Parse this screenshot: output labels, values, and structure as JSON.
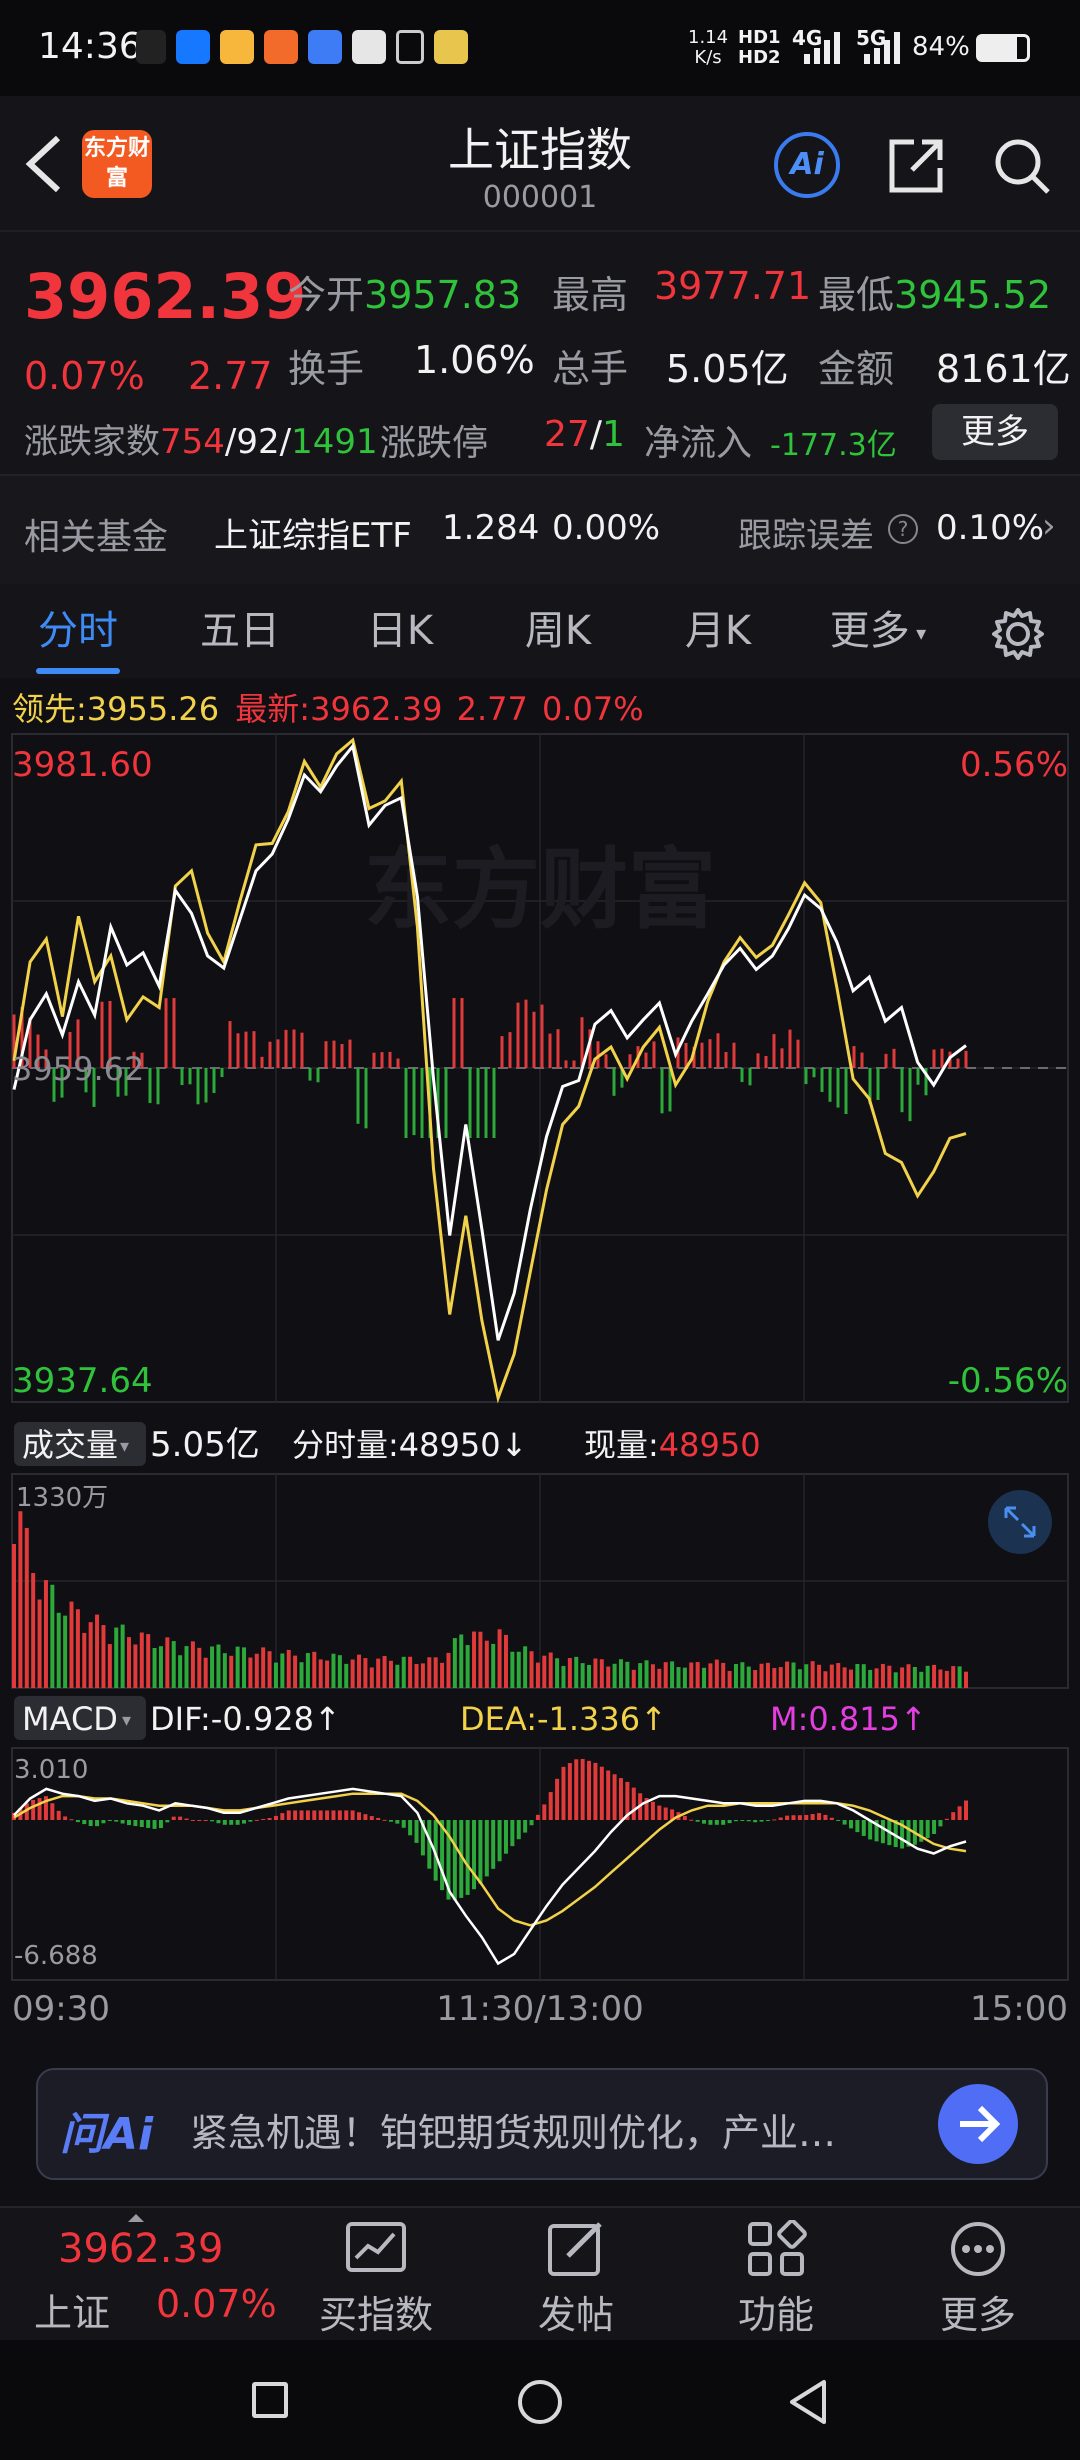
{
  "status_bar": {
    "time": "14:36",
    "net_speed_value": "1.14",
    "net_speed_unit": "K/s",
    "network1": "HD1",
    "network2": "HD2",
    "net_4g": "4G",
    "net_5g": "5G",
    "battery": "84%"
  },
  "header": {
    "logo_text": "东方财富",
    "title": "上证指数",
    "code": "000001",
    "ai_label": "Ai"
  },
  "quote": {
    "price": "3962.39",
    "change_pct": "0.07%",
    "change": "2.77",
    "open_label": "今开",
    "open": "3957.83",
    "high_label": "最高",
    "high": "3977.71",
    "low_label": "最低",
    "low": "3945.52",
    "turnover_label": "换手",
    "turnover": "1.06%",
    "volume_label": "总手",
    "volume": "5.05亿",
    "amount_label": "金额",
    "amount": "8161亿",
    "breadth_label": "涨跌家数",
    "up_count": "754",
    "flat_count": "92",
    "down_count": "1491",
    "limit_label": "涨跌停",
    "limit_up": "27",
    "limit_down": "1",
    "netflow_label": "净流入",
    "netflow": "-177.3亿",
    "more_button": "更多"
  },
  "fund": {
    "label": "相关基金",
    "name": "上证综指ETF",
    "price": "1.284",
    "change": "0.00%",
    "tracking_label": "跟踪误差",
    "tracking_value": "0.10%"
  },
  "tabs": [
    "分时",
    "五日",
    "日K",
    "周K",
    "月K",
    "更多"
  ],
  "legend": {
    "lead_label": "领先:",
    "lead_value": "3955.26",
    "latest_label": "最新:",
    "latest_value": "3962.39",
    "latest_change": "2.77",
    "latest_pct": "0.07%"
  },
  "price_chart": {
    "max_label": "3981.60",
    "min_label": "3937.64",
    "max_pct": "0.56%",
    "min_pct": "-0.56%",
    "prev_close_label": "3959.62",
    "watermark": "东方财富"
  },
  "volume_panel": {
    "selector": "成交量",
    "total": "5.05亿",
    "minute_label": "分时量:",
    "minute_value": "48950",
    "minute_arrow": "↓",
    "current_label": "现量:",
    "current_value": "48950",
    "scale_label": "1330万"
  },
  "macd_panel": {
    "selector": "MACD",
    "dif_label": "DIF:",
    "dif_value": "-0.928",
    "dea_label": "DEA:",
    "dea_value": "-1.336",
    "m_label": "M:",
    "m_value": "0.815",
    "up_arrow": "↑",
    "top_label": "3.010",
    "bottom_label": "-6.688"
  },
  "time_axis": [
    "09:30",
    "11:30/13:00",
    "15:00"
  ],
  "ai_bar": {
    "brand": "问Ai",
    "text": "紧急机遇！铂钯期货规则优化，产业…"
  },
  "bottom_nav": {
    "index_price": "3962.39",
    "index_name": "上证",
    "index_pct": "0.07%",
    "items": [
      "买指数",
      "发帖",
      "功能",
      "更多"
    ]
  },
  "chart_data": [
    {
      "type": "line",
      "title": "",
      "ylim": [
        3937.64,
        3981.6
      ],
      "y_ticks": [
        "3981.60",
        "3959.62",
        "3937.64"
      ],
      "x_ticks": [
        "09:30",
        "11:30/13:00",
        "15:00"
      ],
      "prev_close": 3959.62,
      "series": [
        {
          "name": "最新",
          "color": "#ffffff",
          "values": [
            3958.2,
            3962.8,
            3964.5,
            3961.8,
            3965.3,
            3963.1,
            3968.9,
            3966.4,
            3967.2,
            3965.0,
            3971.3,
            3969.8,
            3967.0,
            3966.2,
            3969.4,
            3972.6,
            3973.7,
            3976.0,
            3978.9,
            3977.8,
            3979.5,
            3980.8,
            3975.6,
            3976.9,
            3977.4,
            3970.9,
            3958.9,
            3948.6,
            3955.9,
            3949.0,
            3941.7,
            3944.8,
            3950.3,
            3955.1,
            3958.4,
            3958.8,
            3962.5,
            3963.4,
            3961.6,
            3962.8,
            3963.9,
            3960.5,
            3962.7,
            3964.5,
            3966.4,
            3967.5,
            3966.1,
            3967.0,
            3968.8,
            3971.0,
            3970.1,
            3967.9,
            3964.7,
            3965.6,
            3962.7,
            3963.6,
            3960.0,
            3958.5,
            3960.3,
            3961.1
          ]
        },
        {
          "name": "领先",
          "color": "#f2d24a",
          "values": [
            3960.1,
            3966.6,
            3968.1,
            3963.0,
            3969.6,
            3965.3,
            3967.0,
            3962.8,
            3964.3,
            3963.6,
            3971.6,
            3972.6,
            3968.5,
            3966.6,
            3970.6,
            3974.3,
            3974.4,
            3976.5,
            3979.8,
            3978.1,
            3980.3,
            3981.2,
            3976.7,
            3977.2,
            3978.5,
            3968.9,
            3953.0,
            3943.4,
            3949.9,
            3943.0,
            3937.9,
            3940.8,
            3946.2,
            3951.6,
            3955.9,
            3957.1,
            3960.2,
            3961.0,
            3958.9,
            3961.0,
            3962.3,
            3958.5,
            3960.2,
            3964.0,
            3966.6,
            3968.2,
            3966.9,
            3967.7,
            3969.7,
            3971.8,
            3970.5,
            3964.9,
            3958.9,
            3957.6,
            3954.0,
            3953.4,
            3951.2,
            3952.8,
            3955.0,
            3955.3
          ]
        }
      ]
    },
    {
      "type": "bar",
      "title": "成交量",
      "ylim": [
        0,
        13300000
      ],
      "y_ticks": [
        "1330万"
      ],
      "x_ticks": [
        "09:30",
        "11:30/13:00",
        "15:00"
      ],
      "series": [
        {
          "name": "成交量",
          "values": [
            13300000,
            8200000,
            6500000,
            5400000,
            4800000,
            4300000,
            3900000,
            3600000,
            3300000,
            3000000,
            2900000,
            2700000,
            2600000,
            2500000,
            2450000,
            2400000,
            2300000,
            2200000,
            2150000,
            2100000,
            2000000,
            1950000,
            1900000,
            1850000,
            1900000,
            1800000,
            1800000,
            2400000,
            3900000,
            3200000,
            3600000,
            2700000,
            2300000,
            2100000,
            1900000,
            1800000,
            1750000,
            1700000,
            1650000,
            1600000,
            1600000,
            1550000,
            1500000,
            1700000,
            1600000,
            1500000,
            1450000,
            1500000,
            1550000,
            1600000,
            1500000,
            1450000,
            1450000,
            1400000,
            1400000,
            1350000,
            1400000,
            1350000,
            1300000,
            1300000
          ]
        }
      ]
    },
    {
      "type": "line",
      "title": "MACD",
      "ylim": [
        -6.688,
        3.01
      ],
      "y_ticks": [
        "3.010",
        "-6.688"
      ],
      "x_ticks": [
        "09:30",
        "11:30/13:00",
        "15:00"
      ],
      "series": [
        {
          "name": "DIF",
          "color": "#ffffff",
          "values": [
            0.2,
            0.9,
            1.3,
            1.1,
            1.0,
            0.8,
            0.9,
            0.7,
            0.6,
            0.4,
            0.7,
            0.6,
            0.5,
            0.3,
            0.3,
            0.5,
            0.7,
            0.9,
            1.0,
            1.1,
            1.2,
            1.3,
            1.2,
            1.1,
            1.0,
            0.3,
            -1.2,
            -3.0,
            -4.0,
            -4.9,
            -6.0,
            -5.6,
            -4.6,
            -3.6,
            -2.7,
            -2.0,
            -1.3,
            -0.5,
            0.2,
            0.7,
            1.0,
            1.0,
            0.9,
            0.8,
            0.7,
            0.7,
            0.6,
            0.6,
            0.7,
            0.8,
            0.8,
            0.7,
            0.4,
            0.0,
            -0.4,
            -0.8,
            -1.2,
            -1.4,
            -1.1,
            -0.9
          ]
        },
        {
          "name": "DEA",
          "color": "#f2d24a",
          "values": [
            0.1,
            0.5,
            0.8,
            1.0,
            1.0,
            0.9,
            0.9,
            0.8,
            0.7,
            0.6,
            0.6,
            0.6,
            0.5,
            0.4,
            0.4,
            0.5,
            0.6,
            0.7,
            0.8,
            0.9,
            1.0,
            1.1,
            1.1,
            1.1,
            1.1,
            0.8,
            0.2,
            -0.7,
            -1.8,
            -2.7,
            -3.7,
            -4.2,
            -4.4,
            -4.2,
            -3.8,
            -3.3,
            -2.8,
            -2.2,
            -1.6,
            -1.0,
            -0.4,
            0.1,
            0.4,
            0.6,
            0.6,
            0.7,
            0.7,
            0.7,
            0.7,
            0.7,
            0.7,
            0.7,
            0.6,
            0.4,
            0.1,
            -0.2,
            -0.6,
            -1.0,
            -1.2,
            -1.3
          ]
        },
        {
          "name": "M",
          "values": [
            0.3,
            0.8,
            1.0,
            0.2,
            -0.1,
            -0.3,
            0.0,
            -0.2,
            -0.3,
            -0.4,
            0.2,
            0.0,
            0.0,
            -0.2,
            -0.2,
            0.0,
            0.1,
            0.4,
            0.4,
            0.4,
            0.4,
            0.4,
            0.2,
            0.0,
            -0.2,
            -1.0,
            -2.4,
            -3.4,
            -3.2,
            -2.6,
            -1.8,
            -1.0,
            -0.3,
            0.8,
            2.2,
            2.6,
            2.4,
            2.0,
            1.6,
            1.0,
            0.6,
            0.4,
            0.0,
            -0.2,
            -0.2,
            0.0,
            -0.1,
            0.0,
            0.2,
            0.2,
            0.3,
            0.0,
            -0.4,
            -0.8,
            -1.0,
            -1.2,
            -1.0,
            -0.6,
            0.2,
            0.815
          ]
        }
      ]
    }
  ]
}
